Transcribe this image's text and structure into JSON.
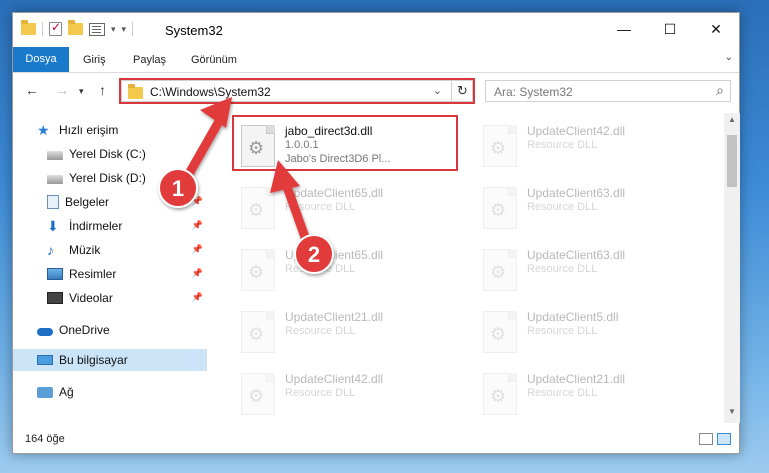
{
  "window": {
    "title": "System32",
    "minimize": "—",
    "maximize": "☐",
    "close": "✕"
  },
  "ribbon": {
    "tabs": [
      "Dosya",
      "Giriş",
      "Paylaş",
      "Görünüm"
    ]
  },
  "address": {
    "path": "C:\\Windows\\System32",
    "search_placeholder": "Ara: System32"
  },
  "sidebar": {
    "items": [
      {
        "label": "Hızlı erişim",
        "icon": "star-icon"
      },
      {
        "label": "Yerel Disk (C:)",
        "icon": "disk-icon"
      },
      {
        "label": "Yerel Disk (D:)",
        "icon": "disk-icon"
      },
      {
        "label": "Belgeler",
        "icon": "documents-icon"
      },
      {
        "label": "İndirmeler",
        "icon": "download-icon"
      },
      {
        "label": "Müzik",
        "icon": "music-icon"
      },
      {
        "label": "Resimler",
        "icon": "pictures-icon"
      },
      {
        "label": "Videolar",
        "icon": "videos-icon"
      },
      {
        "label": "OneDrive",
        "icon": "cloud-icon"
      },
      {
        "label": "Bu bilgisayar",
        "icon": "computer-icon"
      },
      {
        "label": "Ağ",
        "icon": "network-icon"
      }
    ]
  },
  "files": {
    "highlighted": {
      "name": "jabo_direct3d.dll",
      "version": "1.0.0.1",
      "description": "Jabo's Direct3D6 Pl..."
    },
    "others": [
      {
        "name": "UpdateClient42.dll",
        "type": "Resource DLL"
      },
      {
        "name": "UpdateClient65.dll",
        "type": "Resource DLL"
      },
      {
        "name": "UpdateClient63.dll",
        "type": "Resource DLL"
      },
      {
        "name": "UpdateClient65.dll",
        "type": "Resource DLL"
      },
      {
        "name": "UpdateClient63.dll",
        "type": "Resource DLL"
      },
      {
        "name": "UpdateClient21.dll",
        "type": "Resource DLL"
      },
      {
        "name": "UpdateClient5.dll",
        "type": "Resource DLL"
      },
      {
        "name": "UpdateClient42.dll",
        "type": "Resource DLL"
      },
      {
        "name": "UpdateClient21.dll",
        "type": "Resource DLL"
      }
    ]
  },
  "status": {
    "item_count": "164 öğe"
  },
  "callouts": {
    "one": "1",
    "two": "2",
    "color": "#e23b3b"
  }
}
